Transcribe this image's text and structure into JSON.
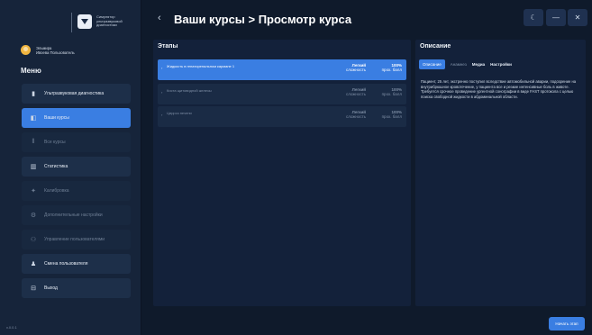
{
  "app": {
    "brand_text": "Симулятор ультразвуковой диагностики",
    "version": "v.0.0.1"
  },
  "user": {
    "first_name": "Эльмира",
    "last_name": "Ивоева Пользователь"
  },
  "menu": {
    "title": "Меню",
    "items": [
      {
        "label": "Ультразвуковая диагностика",
        "icon": "device-icon"
      },
      {
        "label": "Ваши курсы",
        "icon": "book-icon"
      },
      {
        "label": "Все курсы",
        "icon": "library-icon"
      },
      {
        "label": "Статистика",
        "icon": "stats-icon"
      },
      {
        "label": "Калибровка",
        "icon": "calibration-icon"
      },
      {
        "label": "Дополнительные настройки",
        "icon": "gear-icon"
      },
      {
        "label": "Управление пользователями",
        "icon": "users-icon"
      },
      {
        "label": "Смена пользователя",
        "icon": "user-switch-icon"
      },
      {
        "label": "Выход",
        "icon": "exit-icon"
      }
    ]
  },
  "header": {
    "title": "Ваши курсы > Просмотр курса",
    "theme_icon": "moon-icon",
    "minimize_icon": "minimize-icon",
    "close_icon": "close-icon"
  },
  "stages": {
    "title": "Этапы",
    "rows": [
      {
        "name": "Жидкость в гепаторенальном кармане 1",
        "difficulty": "Легкий",
        "difficulty_label": "сложность",
        "score": "100%",
        "score_label": "прох. балл"
      },
      {
        "name": "Киста щитовидной железы",
        "difficulty": "Легкий",
        "difficulty_label": "сложность",
        "score": "100%",
        "score_label": "прох. балл"
      },
      {
        "name": "Цирроз печени",
        "difficulty": "Легкий",
        "difficulty_label": "сложность",
        "score": "100%",
        "score_label": "прох. балл"
      }
    ]
  },
  "description": {
    "title": "Описание",
    "tabs": [
      "Описание",
      "Анамнез",
      "Медиа",
      "Настройки"
    ],
    "text": "Пациент, 25 лет, экстренно поступил вследствие автомобильной аварии, подозрение на внутрибрюшное кровотечение, у пациента все и резкие интенсивные боль в животе. Требуется срочное проведение ургентной сонографии в виде FAST протокола с целью поиска свободной жидкости в абдоминальной области."
  },
  "next_button": "Начать этап",
  "colors": {
    "accent": "#3a7ee2",
    "background": "#0f1a2b",
    "panel": "#13213a"
  }
}
